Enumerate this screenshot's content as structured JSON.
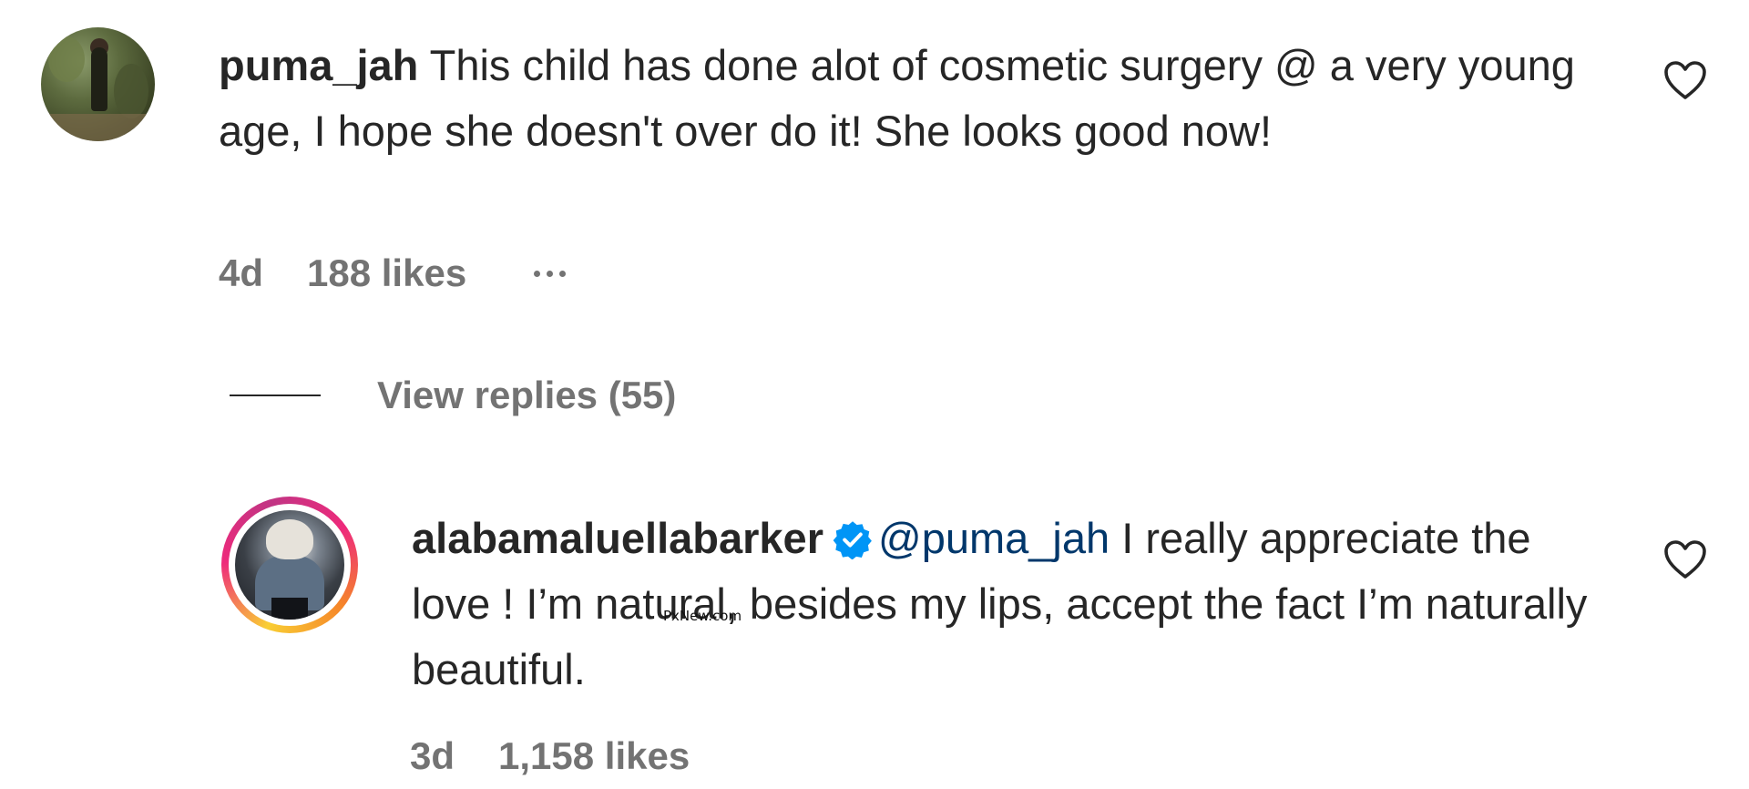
{
  "comments": [
    {
      "username": "puma_jah",
      "text": "This child has done alot of cosmetic surgery @ a very young age, I hope she doesn't over do it! She looks good now!",
      "age": "4d",
      "likes": "188 likes"
    }
  ],
  "view_replies": {
    "label": "View replies (55)"
  },
  "reply": {
    "username": "alabamaluellabarker",
    "mention": "@puma_jah",
    "text": "I really appreciate the love ! I’m natural, besides my lips, accept the fact I’m naturally beautiful.",
    "age": "3d",
    "likes": "1,158 likes"
  },
  "watermark": "PxNew.com",
  "icons": {
    "heart": "heart-outline-icon",
    "verified": "verified-badge-icon",
    "more": "more-horizontal-icon"
  },
  "colors": {
    "text": "#262626",
    "meta": "#737373",
    "mention": "#00376b",
    "verified": "#0095f6"
  }
}
